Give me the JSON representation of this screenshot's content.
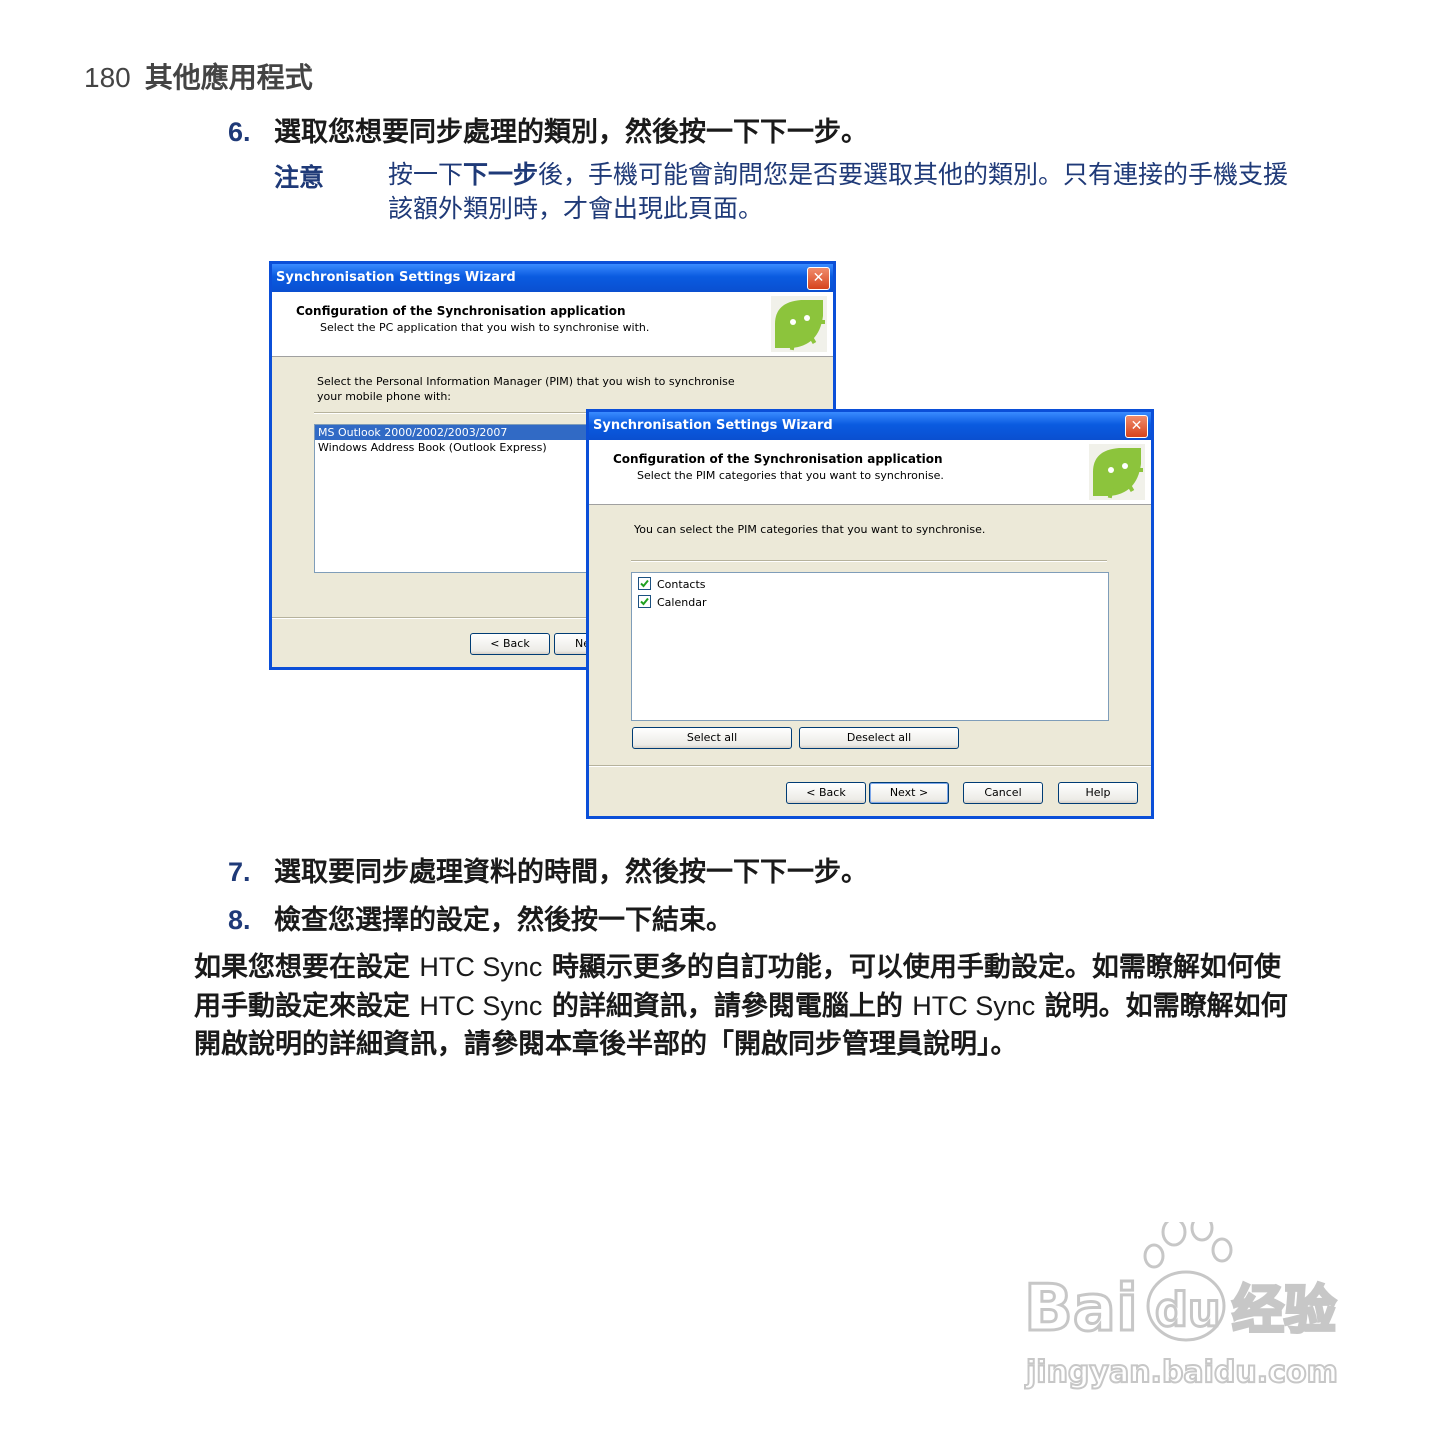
{
  "header": {
    "page_number": "180",
    "section_title": "其他應用程式"
  },
  "steps": {
    "s6": {
      "num": "6.",
      "text_a": "選取您想要同步處理的類別，然後按一下",
      "text_b": "下一步",
      "text_c": "。"
    },
    "s7": {
      "num": "7.",
      "text_a": "選取要同步處理資料的時間，然後按一下",
      "text_b": "下一步",
      "text_c": "。"
    },
    "s8": {
      "num": "8.",
      "text_a": "檢查您選擇的設定，然後按一下",
      "text_b": "結束",
      "text_c": "。"
    }
  },
  "note": {
    "label": "注意",
    "text_a": "按一下",
    "text_b": "下一步",
    "text_c": "後，手機可能會詢問您是否要選取其他的類別。只有連接的手機支援該額外類別時，才會出現此頁面。"
  },
  "paragraph": {
    "p1": "如果您想要在設定 ",
    "p2": "HTC Sync",
    "p3": " 時顯示更多的自訂功能，可以使用手動設定。如需瞭解如何使用手動設定來設定 ",
    "p4": "HTC Sync",
    "p5": " 的詳細資訊，請參閱電腦上的 ",
    "p6": "HTC Sync",
    "p7": " 說明。如需瞭解如何開啟說明的詳細資訊，請參閱本章後半部的「開啟同步管理員說明」。"
  },
  "dialog_back": {
    "title": "Synchronisation Settings Wizard",
    "close": "✕",
    "heading": "Configuration of the Synchronisation application",
    "subheading": "Select the PC application that you wish to synchronise with.",
    "instruction": "Select the Personal Information Manager (PIM) that you wish to synchronise your mobile phone with:",
    "options": [
      "MS Outlook 2000/2002/2003/2007",
      "Windows Address Book (Outlook Express)"
    ],
    "selected_index": 0,
    "back_label": "< Back",
    "next_label_partial": "Ne"
  },
  "dialog_front": {
    "title": "Synchronisation Settings Wizard",
    "close": "✕",
    "heading": "Configuration of the Synchronisation application",
    "subheading": "Select the PIM categories that you want to synchronise.",
    "instruction": "You can select the PIM categories that you want to synchronise.",
    "categories": [
      {
        "label": "Contacts",
        "checked": true
      },
      {
        "label": "Calendar",
        "checked": true
      }
    ],
    "select_all": "Select all",
    "deselect_all": "Deselect all",
    "back_label": "< Back",
    "next_label": "Next >",
    "cancel_label": "Cancel",
    "help_label": "Help"
  },
  "watermark": {
    "text_top": "Bai",
    "text_du": "du",
    "text_cn": "经验",
    "url": "jingyan.baidu.com"
  },
  "colors": {
    "note_blue": "#1f3a78",
    "xp_title_blue": "#0a5be0",
    "xp_face": "#ece9d8",
    "android_green": "#8cc43c"
  }
}
